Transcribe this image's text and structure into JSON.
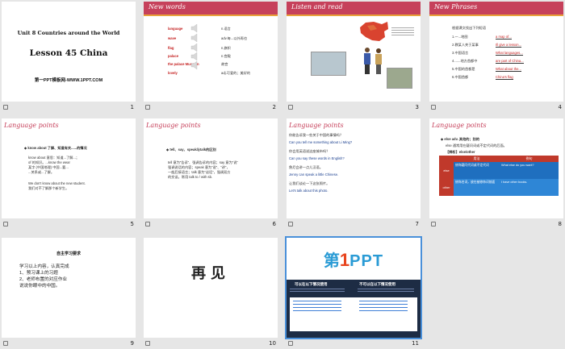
{
  "slides": [
    {
      "num": "1",
      "title1": "Unit 8 Countries around the World",
      "title2": "Lesson 45 China",
      "footer": "第一PPT模板网-WWW.1PPT.COM"
    },
    {
      "num": "2",
      "header": "New words",
      "words": [
        {
          "en": "language",
          "zh": "n.语言"
        },
        {
          "en": "wave",
          "zh": "adv.每...以外再也"
        },
        {
          "en": "flag",
          "zh": "n.旗帜"
        },
        {
          "en": "palace",
          "zh": "n.宫殿"
        },
        {
          "en": "the palace Museum",
          "zh": "故宫"
        },
        {
          "en": "lovely",
          "zh": "adj.可爱的；美好的"
        }
      ]
    },
    {
      "num": "3",
      "header": "Listen and read"
    },
    {
      "num": "4",
      "header": "New Phrases",
      "intro": "根据课文找出下列短语",
      "phrases": [
        {
          "zh": "1.一...地图",
          "en": "a map of..."
        },
        {
          "zh": "2.教某人关于某事",
          "en": "Ill give a lesson..."
        },
        {
          "zh": "3.中国语言",
          "en": "What languages..."
        },
        {
          "zh": "4.......地方首都中",
          "en": "are part of China..."
        },
        {
          "zh": "5.中国的首都是",
          "en": "What about the..."
        },
        {
          "zh": "6.中国首都",
          "en": "China's flag"
        }
      ]
    },
    {
      "num": "5",
      "header": "Language points",
      "lines": [
        "◆ know about 了解、知道有关......的情况",
        "know about 意思：知道...了解...；",
        "of 的知识。...know the wear",
        "某字 (中国地理) 中国...要...",
        "...关系或...了解。",
        "We don't know about the new student.",
        "我们对不了解那个新学生。"
      ]
    },
    {
      "num": "6",
      "header": "Language points",
      "lines": [
        "◆ tell、say、speak与talk的区别",
        "tell 意为“告诉”、强调告诉的内容；say 意为“说”",
        "强调说话的内容；speak 意为“说”、“讲”，",
        "一般后接语言；talk 意为“谈话”，强调双方",
        "的交谈。常用 talk to / with sb."
      ]
    },
    {
      "num": "7",
      "header": "Language points",
      "lines": [
        "你能告诉我一些关于中国的事情吗？",
        "Can you tell me something about Li Ming?",
        "你会用英语说这座城市吗？",
        "Can you say these words in English?",
        "詹尼会讲一点儿汉语。",
        "Jenny can speak a little Chinese.",
        "让我们谈论一下这张照片。",
        "Let's talk about this photo."
      ]
    },
    {
      "num": "8",
      "header": "Language points",
      "lines": [
        "◆ else adv. 其他的；别的",
        "else 通常用在疑问词或不定代词的后面。",
        "【辨析】else/other"
      ],
      "table_head": [
        "",
        "用法",
        "例句"
      ],
      "table_rows": [
        {
          "k": "else",
          "use": "修饰疑问代词或不定代词",
          "ex": "What else do you want?"
        },
        {
          "k": "other",
          "use": "修饰名词，放在被修饰词前面",
          "ex": "I have other books."
        }
      ]
    },
    {
      "num": "9",
      "title": "自主学习要求",
      "lines": [
        "学习以上内容，认真完成",
        "1、预习课上的习题",
        "2、老师布置的对应作业",
        "说说你眼中的中国。"
      ]
    },
    {
      "num": "10",
      "text": "再见"
    },
    {
      "num": "11",
      "logo_prefix": "第",
      "logo_num": "1",
      "logo_suffix": "PPT",
      "panel_left": "可以在以下情况使用",
      "panel_right": "不可以在以下情况使用"
    }
  ]
}
